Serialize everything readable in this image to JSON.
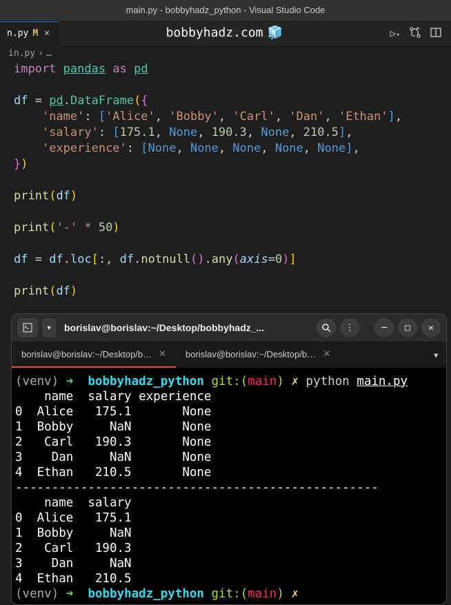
{
  "titlebar": {
    "text": "main.py - bobbyhadz_python - Visual Studio Code"
  },
  "tab": {
    "filename": "n.py",
    "modified_marker": "M",
    "close": "×"
  },
  "center_title": "bobbyhadz.com",
  "breadcrumb": {
    "file": "in.py",
    "sep": "›",
    "rest": "…"
  },
  "code": {
    "l1_import": "import",
    "l1_pandas": "pandas",
    "l1_as": "as",
    "l1_pd": "pd",
    "l3_df": "df",
    "l3_eq": "=",
    "l3_pd": "pd",
    "l3_DataFrame": "DataFrame",
    "l4_name": "'name'",
    "l4_v1": "'Alice'",
    "l4_v2": "'Bobby'",
    "l4_v3": "'Carl'",
    "l4_v4": "'Dan'",
    "l4_v5": "'Ethan'",
    "l5_salary": "'salary'",
    "l5_v1": "175.1",
    "l5_v2": "None",
    "l5_v3": "190.3",
    "l5_v4": "None",
    "l5_v5": "210.5",
    "l6_exp": "'experience'",
    "l6_none": "None",
    "l8_print": "print",
    "l8_df": "df",
    "l10_print": "print",
    "l10_dash": "'-'",
    "l10_star": "*",
    "l10_fifty": "50",
    "l12_df": "df",
    "l12_eq": "=",
    "l12_df2": "df",
    "l12_loc": "loc",
    "l12_notnull": "notnull",
    "l12_any": "any",
    "l12_axis": "axis",
    "l12_zero": "0",
    "l14_print": "print",
    "l14_df": "df"
  },
  "terminal": {
    "header_title": "borislav@borislav:~/Desktop/bobbyhadz_...",
    "tab1": "borislav@borislav:~/Desktop/b…",
    "tab2": "borislav@borislav:~/Desktop/b…",
    "prompt": {
      "venv": "(venv)",
      "arrow": "➜",
      "dir": "bobbyhadz_python",
      "git": "git:(",
      "branch": "main",
      "gitclose": ")",
      "dirty": "✗",
      "cmd": "python",
      "script": "main.py"
    },
    "output1": "    name  salary experience\n0  Alice   175.1       None\n1  Bobby     NaN       None\n2   Carl   190.3       None\n3    Dan     NaN       None\n4  Ethan   210.5       None",
    "divider": "--------------------------------------------------",
    "output2": "    name  salary\n0  Alice   175.1\n1  Bobby     NaN\n2   Carl   190.3\n3    Dan     NaN\n4  Ethan   210.5"
  }
}
